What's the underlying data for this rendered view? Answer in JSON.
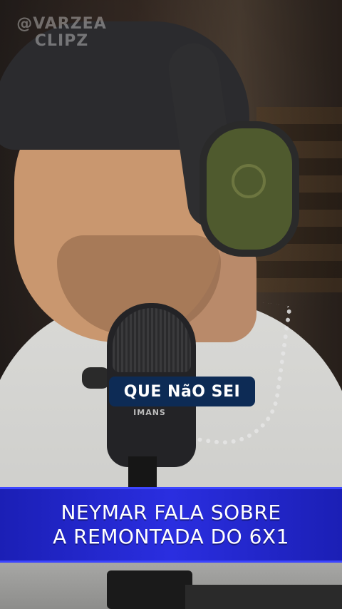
{
  "watermark": {
    "line1": "@VARZEA",
    "line2": "CLIPZ"
  },
  "subtitle": {
    "text": "QUE NãO SEI"
  },
  "title": {
    "line1": "NEYMAR FALA SOBRE",
    "line2": "A REMONTADA DO 6X1"
  },
  "microphone": {
    "brand": "IMANS"
  },
  "colors": {
    "title_bar": "#2a2ee0",
    "subtitle_bg": "#0d2b55",
    "text": "#ffffff"
  }
}
